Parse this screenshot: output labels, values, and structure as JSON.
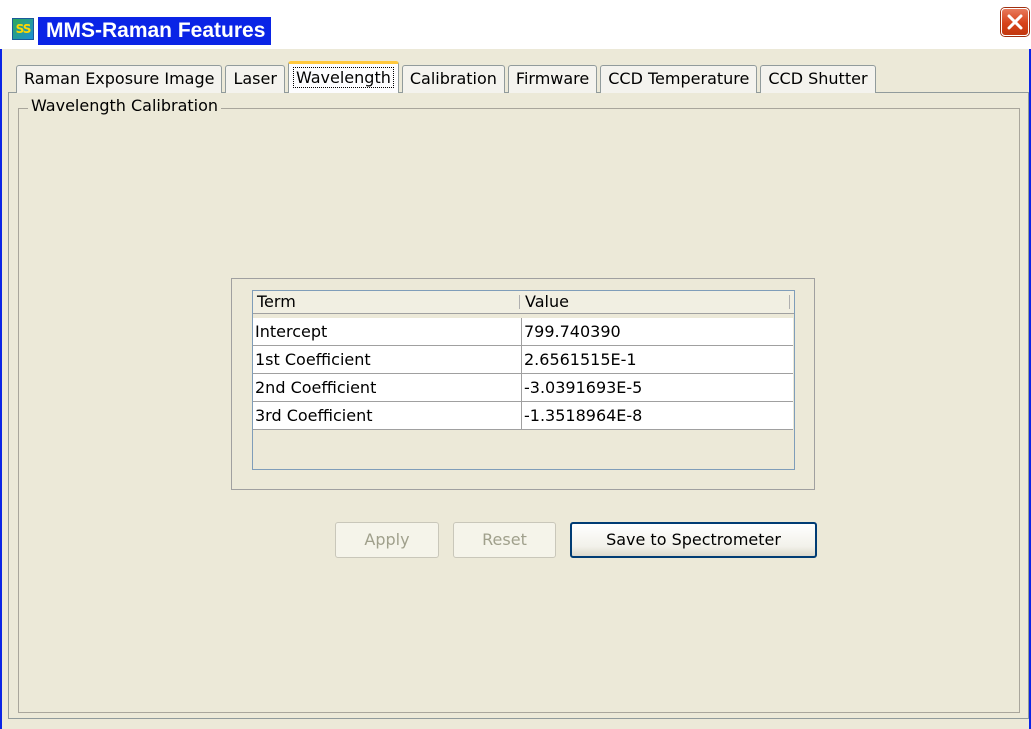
{
  "window": {
    "icon_text": "SS",
    "title": "MMS-Raman Features"
  },
  "tabs": [
    {
      "label": "Raman Exposure Image"
    },
    {
      "label": "Laser"
    },
    {
      "label": "Wavelength",
      "active": true
    },
    {
      "label": "Calibration"
    },
    {
      "label": "Firmware"
    },
    {
      "label": "CCD Temperature"
    },
    {
      "label": "CCD Shutter"
    }
  ],
  "group": {
    "title": "Wavelength Calibration"
  },
  "table": {
    "columns": [
      "Term",
      "Value"
    ],
    "rows": [
      {
        "term": "Intercept",
        "value": "799.740390"
      },
      {
        "term": "1st Coefficient",
        "value": "2.6561515E-1"
      },
      {
        "term": "2nd Coefficient",
        "value": "-3.0391693E-5"
      },
      {
        "term": "3rd Coefficient",
        "value": "-1.3518964E-8"
      }
    ]
  },
  "buttons": {
    "apply": "Apply",
    "reset": "Reset",
    "save": "Save to Spectrometer"
  },
  "colors": {
    "title_bg": "#0a24e6",
    "active_tab_accent": "#ffc83c",
    "close_button": "#d7421a"
  }
}
